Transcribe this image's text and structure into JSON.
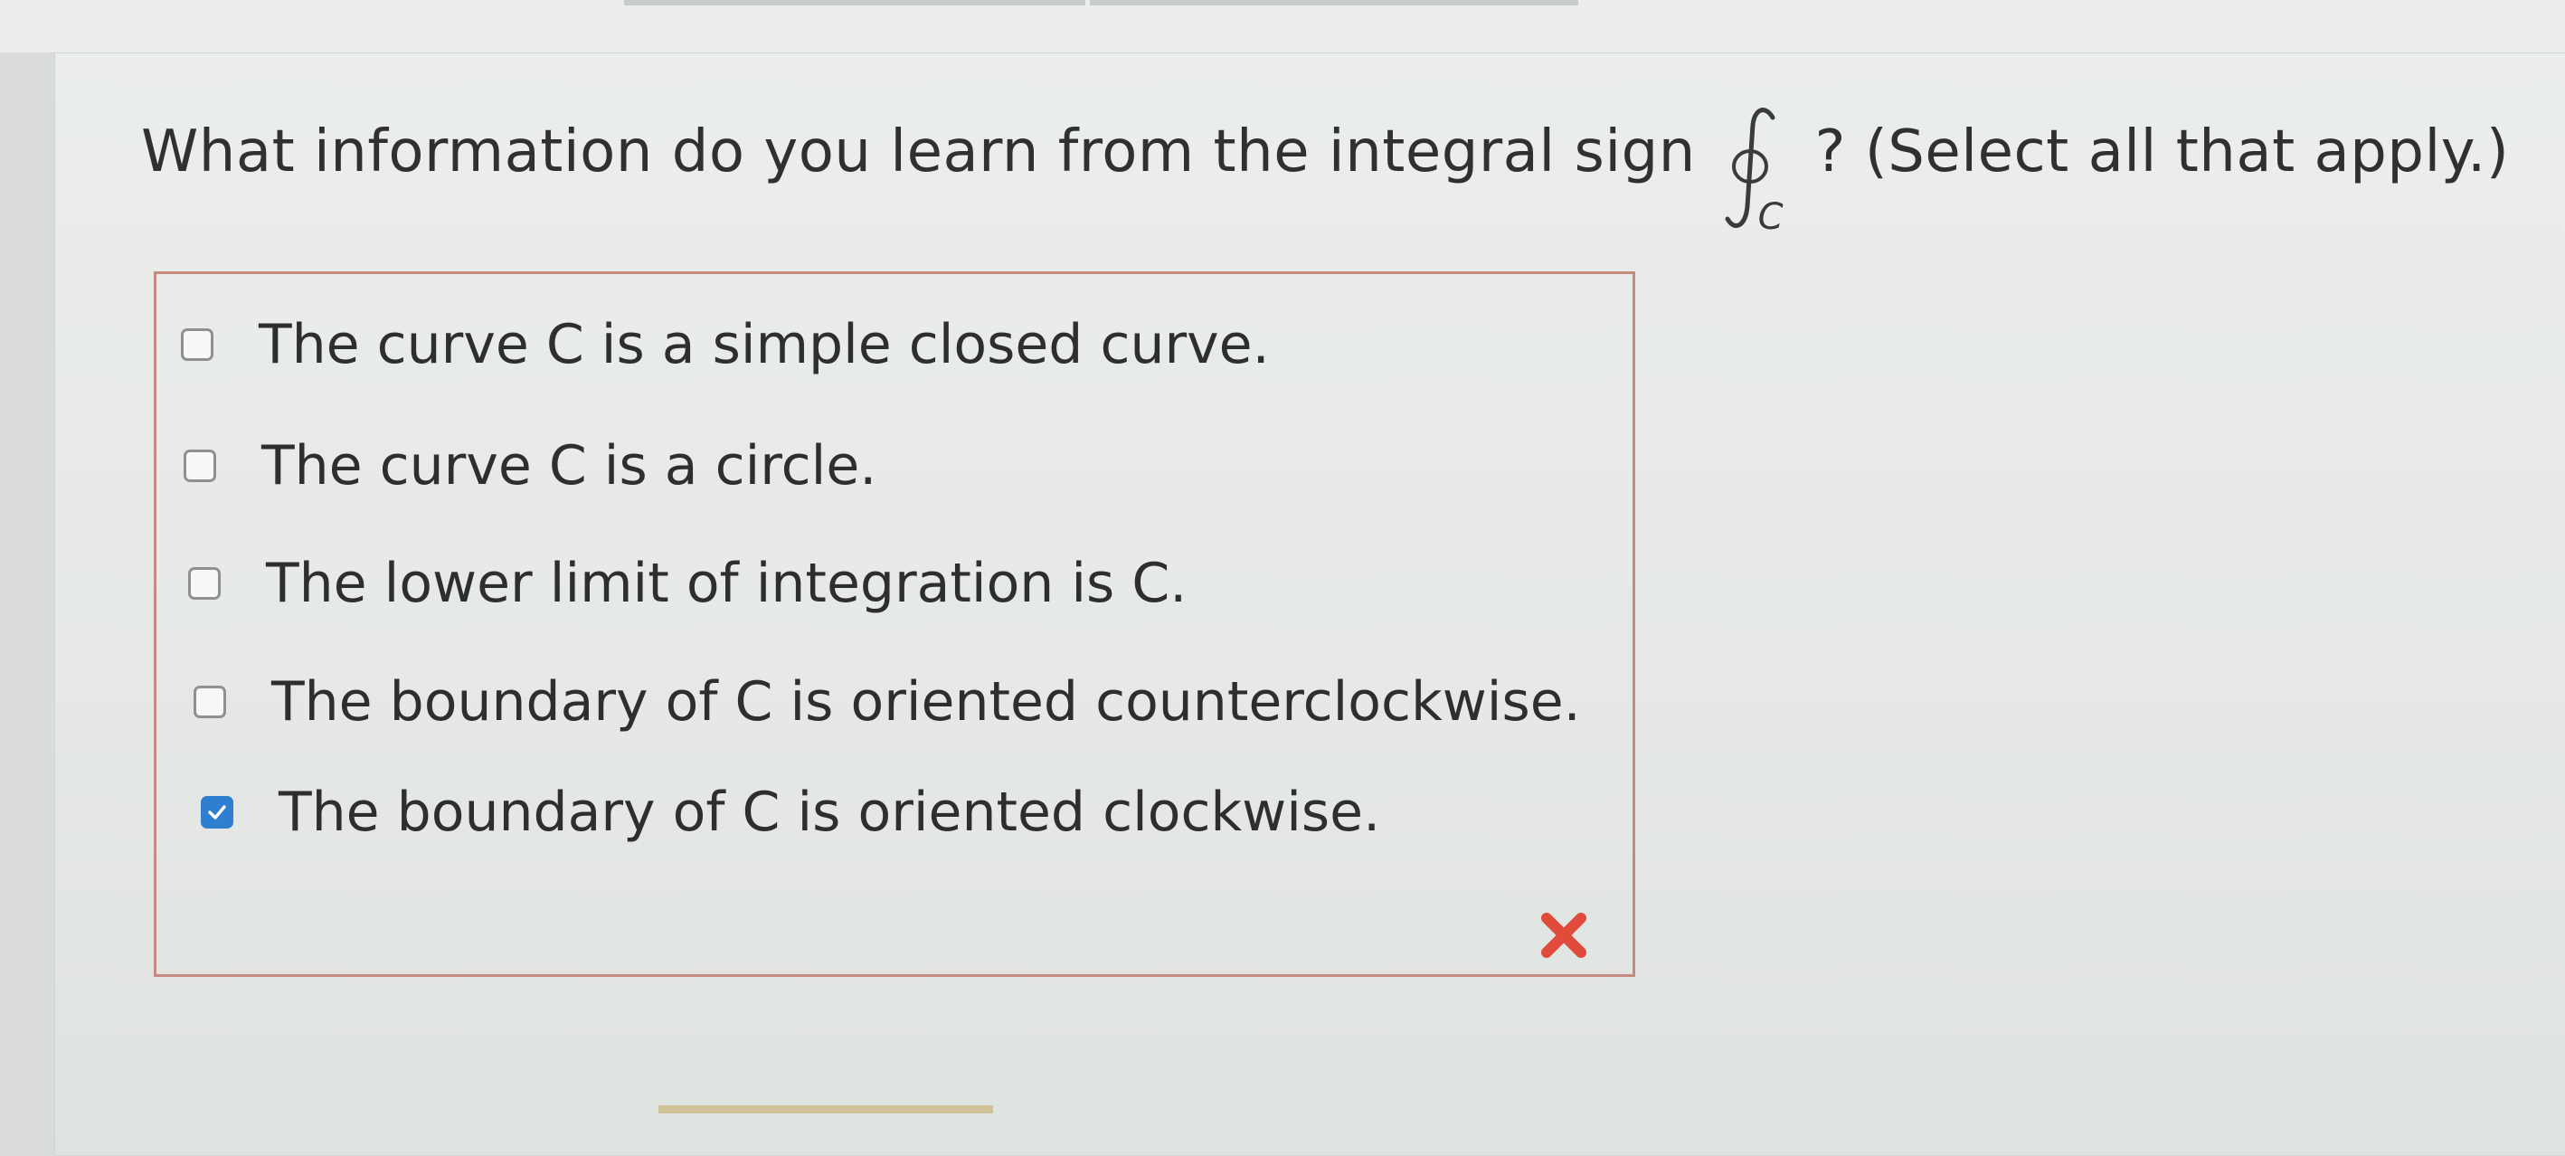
{
  "question": {
    "prefix": "What information do you learn from the integral sign",
    "integral_subscript": "C",
    "suffix": "? (Select all that apply.)"
  },
  "options": [
    {
      "label": "The curve C is a simple closed curve.",
      "checked": false
    },
    {
      "label": "The curve C is a circle.",
      "checked": false
    },
    {
      "label": "The lower limit of integration is C.",
      "checked": false
    },
    {
      "label": "The boundary of C is oriented counterclockwise.",
      "checked": false
    },
    {
      "label": "The boundary of C is oriented clockwise.",
      "checked": true
    }
  ],
  "result": {
    "icon": "incorrect-x-icon",
    "color": "#e14b3b"
  },
  "colors": {
    "checkbox_checked": "#2f7fd1",
    "box_border": "#c48b80"
  }
}
